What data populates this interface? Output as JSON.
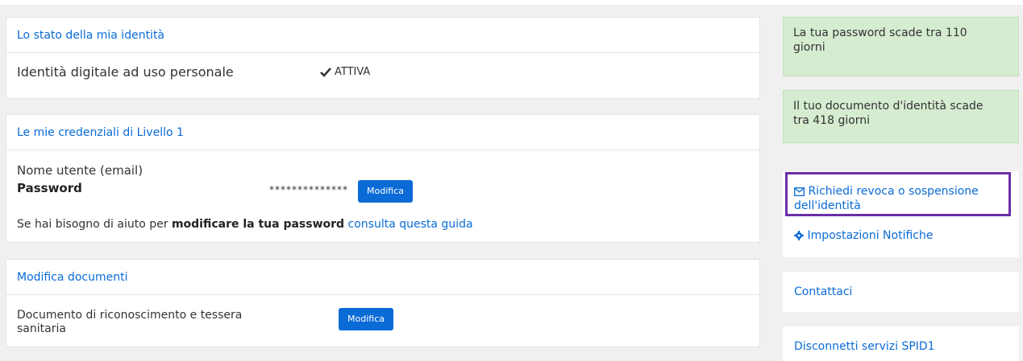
{
  "identity": {
    "title": "Lo stato della mia identità",
    "row_label": "Identità digitale ad uso personale",
    "status": "ATTIVA"
  },
  "credentials": {
    "title": "Le mie credenziali di Livello 1",
    "username_label": "Nome utente (email)",
    "password_label": "Password",
    "password_mask": "**************",
    "modify_button": "Modifica",
    "help_prefix": "Se hai bisogno di aiuto per ",
    "help_bold": "modificare la tua password",
    "help_link": "consulta questa guida"
  },
  "documents": {
    "title": "Modifica documenti",
    "row_label_line1": "Documento di riconoscimento e tessera",
    "row_label_line2": "sanitaria",
    "modify_button": "Modifica"
  },
  "sidebar": {
    "password_alert_line1": "La tua password scade tra 110",
    "password_alert_line2": "giorni",
    "document_alert_line1": "Il tuo documento d'identità scade",
    "document_alert_line2": "tra 418 giorni",
    "revoke_link_line1": "Richiedi revoca o sospensione",
    "revoke_link_line2": "dell'identità",
    "notifications_link": "Impostazioni Notifiche",
    "contact_link": "Contattaci",
    "disconnect_link": "Disconnetti servizi SPID1"
  },
  "colors": {
    "link_blue": "#0a6bd6",
    "alert_green": "#d6ecd1",
    "highlight_purple": "#6a2ea8"
  }
}
